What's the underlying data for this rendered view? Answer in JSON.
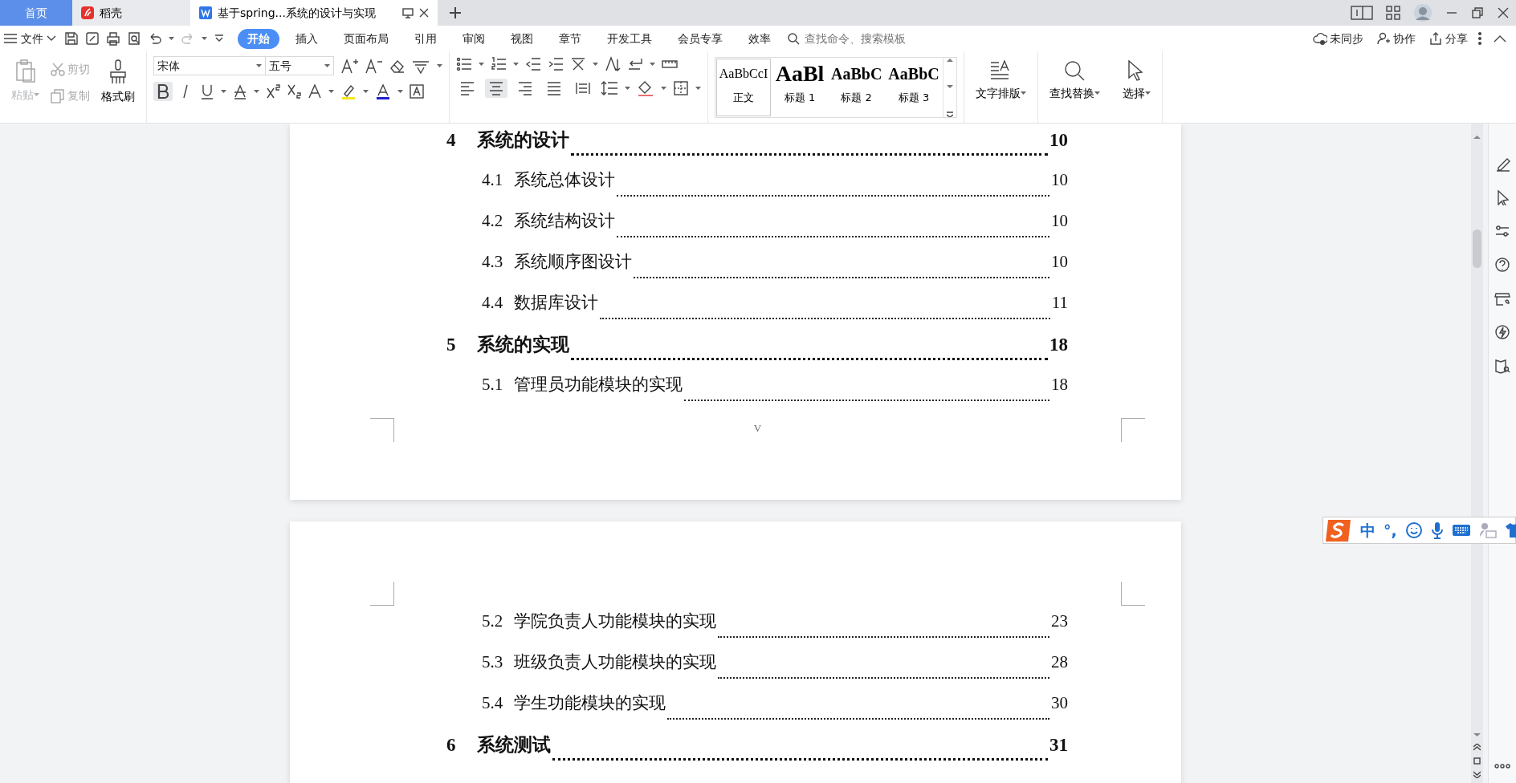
{
  "tabs": [
    {
      "kind": "home",
      "label": "首页",
      "selected": false
    },
    {
      "kind": "app",
      "label": "稻壳",
      "selected": false
    },
    {
      "kind": "doc",
      "label": "基于spring...系统的设计与实现",
      "selected": true
    }
  ],
  "menu": {
    "file": "文件",
    "tabs": [
      {
        "label": "开始",
        "selected": true
      },
      {
        "label": "插入",
        "selected": false
      },
      {
        "label": "页面布局",
        "selected": false
      },
      {
        "label": "引用",
        "selected": false
      },
      {
        "label": "审阅",
        "selected": false
      },
      {
        "label": "视图",
        "selected": false
      },
      {
        "label": "章节",
        "selected": false
      },
      {
        "label": "开发工具",
        "selected": false
      },
      {
        "label": "会员专享",
        "selected": false
      },
      {
        "label": "效率",
        "selected": false
      }
    ],
    "search": {
      "placeholder": "查找命令、搜索模板"
    },
    "actions": [
      "未同步",
      "协作",
      "分享"
    ]
  },
  "ribbon": {
    "paste": {
      "label": "粘贴",
      "disabled": true
    },
    "cut": {
      "label": "剪切",
      "disabled": true
    },
    "copy": {
      "label": "复制",
      "disabled": true
    },
    "format_painter": {
      "label": "格式刷",
      "disabled": false
    },
    "font": {
      "name": "宋体",
      "size": "五号"
    },
    "bold": true,
    "alignment": [
      {
        "kind": "left",
        "selected": false
      },
      {
        "kind": "center",
        "selected": true
      },
      {
        "kind": "right",
        "selected": false
      },
      {
        "kind": "justify",
        "selected": false
      },
      {
        "kind": "distributed",
        "selected": false
      }
    ],
    "styles": [
      {
        "preview": "AaBbCcI",
        "label": "正文",
        "selected": true
      },
      {
        "preview": "AaBl",
        "label": "标题 1",
        "selected": false
      },
      {
        "preview": "AaBbC",
        "label": "标题 2",
        "selected": false
      },
      {
        "preview": "AaBbC",
        "label": "标题 3",
        "selected": false
      }
    ],
    "tools": [
      "文字排版",
      "查找替换",
      "选择"
    ]
  },
  "pages": [
    {
      "entries": [
        {
          "kind": "chapter",
          "number": "4",
          "title": "系统的设计",
          "page": "10"
        },
        {
          "kind": "section",
          "number": "4.1",
          "title": "系统总体设计",
          "page": "10"
        },
        {
          "kind": "section",
          "number": "4.2",
          "title": "系统结构设计",
          "page": "10"
        },
        {
          "kind": "section",
          "number": "4.3",
          "title": "系统顺序图设计",
          "page": "10"
        },
        {
          "kind": "section",
          "number": "4.4",
          "title": "数据库设计",
          "page": "11"
        },
        {
          "kind": "chapter",
          "number": "5",
          "title": "系统的实现",
          "page": "18"
        },
        {
          "kind": "section",
          "number": "5.1",
          "title": "管理员功能模块的实现",
          "page": "18"
        }
      ],
      "footer": "V"
    },
    {
      "entries": [
        {
          "kind": "section",
          "number": "5.2",
          "title": "学院负责人功能模块的实现",
          "page": "23"
        },
        {
          "kind": "section",
          "number": "5.3",
          "title": "班级负责人功能模块的实现",
          "page": "28"
        },
        {
          "kind": "section",
          "number": "5.4",
          "title": "学生功能模块的实现",
          "page": "30"
        },
        {
          "kind": "chapter",
          "number": "6",
          "title": "系统测试",
          "page": "31"
        }
      ]
    }
  ],
  "ime": {
    "mode": "中",
    "punctuation": "°,"
  }
}
